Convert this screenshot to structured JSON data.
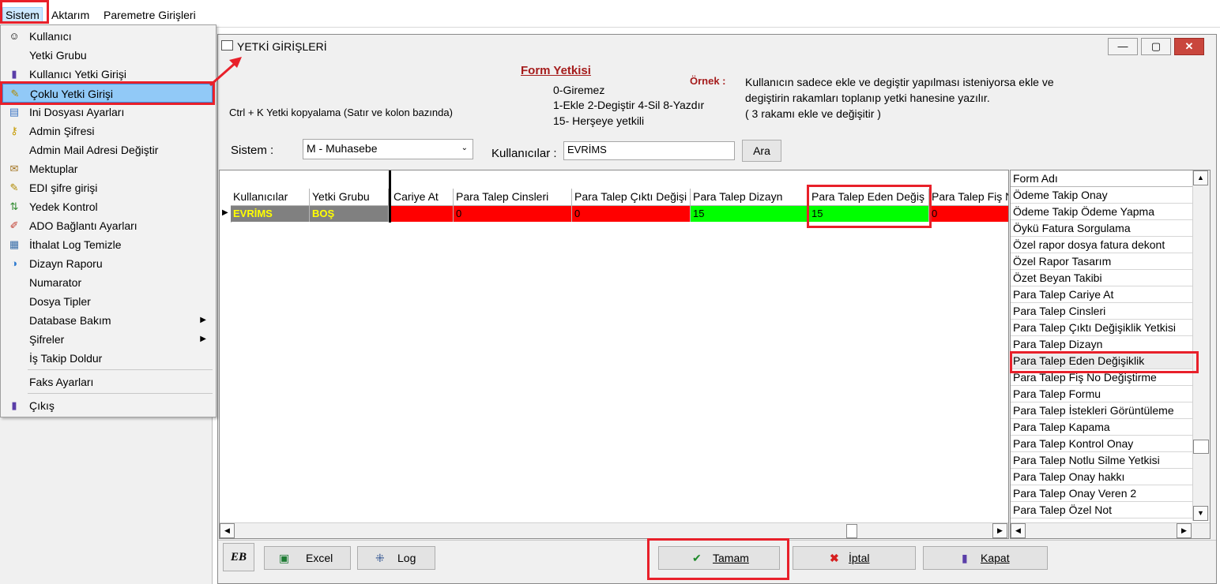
{
  "menubar": {
    "items": [
      "Sistem",
      "Aktarım",
      "Paremetre Girişleri"
    ]
  },
  "dropdown": {
    "items": [
      {
        "label": "Kullanıcı",
        "icon": "user-icon"
      },
      {
        "label": "Yetki Grubu",
        "icon": ""
      },
      {
        "label": "Kullanıcı Yetki Girişi",
        "icon": "bottle-icon"
      },
      {
        "label": "Çoklu Yetki Girişi",
        "icon": "key-tools-icon",
        "highlighted": true
      },
      {
        "label": "Ini Dosyası  Ayarları",
        "icon": "settings-file-icon"
      },
      {
        "label": "Admin Şifresi",
        "icon": "key-icon"
      },
      {
        "label": "Admin Mail Adresi Değiştir",
        "icon": ""
      },
      {
        "label": "Mektuplar",
        "icon": "mail-icon"
      },
      {
        "label": "EDI şifre girişi",
        "icon": "key-tools-icon"
      },
      {
        "label": "Yedek Kontrol",
        "icon": "backup-icon"
      },
      {
        "label": "ADO Bağlantı Ayarları",
        "icon": "connection-icon"
      },
      {
        "label": "İthalat Log Temizle",
        "icon": "log-icon"
      },
      {
        "label": "Dizayn Raporu",
        "icon": "design-icon"
      },
      {
        "label": "Numarator",
        "icon": ""
      },
      {
        "label": "Dosya Tipler",
        "icon": ""
      },
      {
        "label": "Database Bakım",
        "icon": "",
        "submenu": true
      },
      {
        "label": "Şifreler",
        "icon": "",
        "submenu": true
      },
      {
        "label": "İş Takip Doldur",
        "icon": ""
      },
      {
        "label": "Faks Ayarları",
        "icon": ""
      },
      {
        "label": "Çıkış",
        "icon": "exit-icon"
      }
    ]
  },
  "window": {
    "title": "YETKİ GİRİŞLERİ",
    "controls": {
      "minimize": "—",
      "maximize": "▢",
      "close": "✕"
    }
  },
  "info": {
    "form_yetkisi_title": "Form Yetkisi",
    "codes": [
      "0-Giremez",
      "1-Ekle  2-Degiştir  4-Sil  8-Yazdır",
      "15- Herşeye yetkili"
    ],
    "ornek_label": "Örnek :",
    "ornek_text": [
      "Kullanıcın sadece ekle ve degiştir yapılması isteniyorsa  ekle ve",
      "degiştirin rakamları toplanıp yetki hanesine yazılır.",
      " ( 3 rakamı ekle ve değişitir )"
    ],
    "ctrl_k_hint": "Ctrl + K Yetki kopyalama (Satır ve kolon bazında)"
  },
  "filters": {
    "sistem_label": "Sistem :",
    "sistem_value": "M - Muhasebe",
    "kullanicilar_label": "Kullanıcılar :",
    "kullanicilar_value": "EVRİMS",
    "ara_button": "Ara"
  },
  "grid": {
    "columns": [
      "Kullanıcılar",
      "Yetki Grubu",
      "Para Talep Cariye At",
      "Para Talep Cinsleri",
      "Para Talep Çıktı Değişiklik Yetkisi",
      "Para Talep Dizayn",
      "Para Talep Eden Değişiklik",
      "Para Talep Fiş No Değiştirme"
    ],
    "visible_headers": [
      "Kullanıcılar",
      "Yetki Grubu",
      "Cariye At",
      "Para Talep Cinsleri",
      "Para Talep Çıktı Değişi",
      "Para Talep Dizayn",
      "Para Talep Eden Değiş",
      "Para Talep Fiş N"
    ],
    "rows": [
      {
        "user": "EVRİMS",
        "group": "BOŞ",
        "values": [
          "",
          "0",
          "0",
          "15",
          "15",
          "0"
        ]
      }
    ],
    "colors": {
      "red": "#ff0000",
      "green": "#00ff00",
      "user_bg": "#808080",
      "user_text": "#ffff00"
    }
  },
  "formlist": {
    "header": "Form Adı",
    "items": [
      "Ödeme Takip Onay",
      "Ödeme Takip Ödeme Yapma",
      "Öykü Fatura Sorgulama",
      "Özel rapor dosya fatura dekont",
      "Özel Rapor Tasarım",
      "Özet Beyan Takibi",
      "Para Talep Cariye At",
      "Para Talep Cinsleri",
      "Para Talep Çıktı Değişiklik Yetkisi",
      "Para Talep Dizayn",
      "Para Talep Eden Değişiklik",
      "Para Talep Fiş No Değiştirme",
      "Para Talep Formu",
      "Para Talep İstekleri Görüntüleme",
      "Para Talep Kapama",
      "Para Talep Kontrol Onay",
      "Para Talep Notlu Silme Yetkisi",
      "Para Talep Onay hakkı",
      "Para Talep Onay Veren 2",
      "Para Talep Özel Not"
    ],
    "selected_index": 10
  },
  "bottom": {
    "eb_label": "EB",
    "excel": "Excel",
    "log": "Log",
    "tamam": "Tamam",
    "iptal": "İptal",
    "kapat": "Kapat"
  }
}
